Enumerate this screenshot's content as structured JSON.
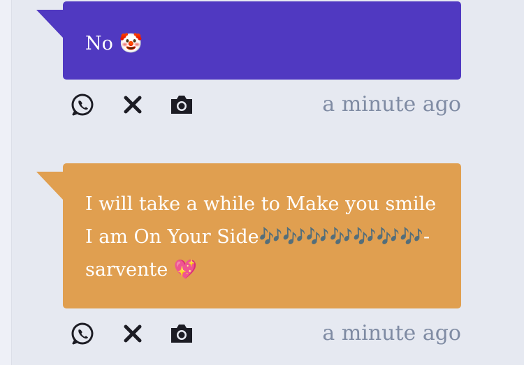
{
  "messages": [
    {
      "text": "No 🤡",
      "color": "#5039c1",
      "timestamp": "a minute ago"
    },
    {
      "text": "I will take a while to Make you smile I am On Your Side🎶🎶🎶🎶🎶🎶🎶-sarvente 💖",
      "color": "#e09f50",
      "timestamp": "a minute ago"
    }
  ],
  "actions": {
    "icons": [
      "whatsapp-icon",
      "close-icon",
      "camera-icon"
    ]
  },
  "colors": {
    "background": "#e6e9f1",
    "timestamp": "#7f8ba3",
    "icon": "#1c1c24"
  }
}
